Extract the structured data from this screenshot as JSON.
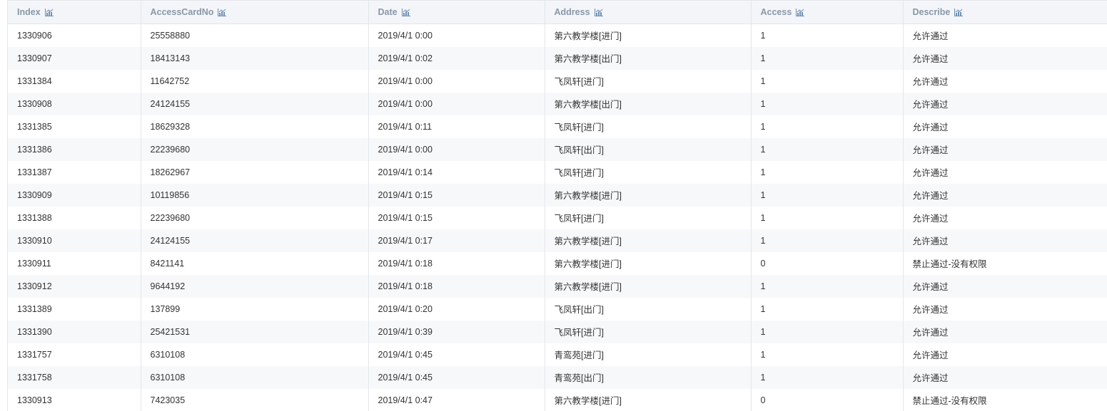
{
  "table": {
    "columns": [
      {
        "label": "Index",
        "icon": "chart-icon"
      },
      {
        "label": "AccessCardNo",
        "icon": "chart-icon"
      },
      {
        "label": "Date",
        "icon": "chart-icon"
      },
      {
        "label": "Address",
        "icon": "chart-icon"
      },
      {
        "label": "Access",
        "icon": "chart-icon"
      },
      {
        "label": "Describe",
        "icon": "chart-icon"
      }
    ],
    "rows": [
      [
        "1330906",
        "25558880",
        "2019/4/1 0:00",
        "第六教学楼[进门]",
        "1",
        "允许通过"
      ],
      [
        "1330907",
        "18413143",
        "2019/4/1 0:02",
        "第六教学楼[出门]",
        "1",
        "允许通过"
      ],
      [
        "1331384",
        "11642752",
        "2019/4/1 0:00",
        "飞凤轩[进门]",
        "1",
        "允许通过"
      ],
      [
        "1330908",
        "24124155",
        "2019/4/1 0:00",
        "第六教学楼[出门]",
        "1",
        "允许通过"
      ],
      [
        "1331385",
        "18629328",
        "2019/4/1 0:11",
        "飞凤轩[进门]",
        "1",
        "允许通过"
      ],
      [
        "1331386",
        "22239680",
        "2019/4/1 0:00",
        "飞凤轩[出门]",
        "1",
        "允许通过"
      ],
      [
        "1331387",
        "18262967",
        "2019/4/1 0:14",
        "飞凤轩[进门]",
        "1",
        "允许通过"
      ],
      [
        "1330909",
        "10119856",
        "2019/4/1 0:15",
        "第六教学楼[进门]",
        "1",
        "允许通过"
      ],
      [
        "1331388",
        "22239680",
        "2019/4/1 0:15",
        "飞凤轩[进门]",
        "1",
        "允许通过"
      ],
      [
        "1330910",
        "24124155",
        "2019/4/1 0:17",
        "第六教学楼[进门]",
        "1",
        "允许通过"
      ],
      [
        "1330911",
        "8421141",
        "2019/4/1 0:18",
        "第六教学楼[进门]",
        "0",
        "禁止通过-没有权限"
      ],
      [
        "1330912",
        "9644192",
        "2019/4/1 0:18",
        "第六教学楼[进门]",
        "1",
        "允许通过"
      ],
      [
        "1331389",
        "137899",
        "2019/4/1 0:20",
        "飞凤轩[出门]",
        "1",
        "允许通过"
      ],
      [
        "1331390",
        "25421531",
        "2019/4/1 0:39",
        "飞凤轩[进门]",
        "1",
        "允许通过"
      ],
      [
        "1331757",
        "6310108",
        "2019/4/1 0:45",
        "青鸾苑[进门]",
        "1",
        "允许通过"
      ],
      [
        "1331758",
        "6310108",
        "2019/4/1 0:45",
        "青鸾苑[出门]",
        "1",
        "允许通过"
      ],
      [
        "1330913",
        "7423035",
        "2019/4/1 0:47",
        "第六教学楼[进门]",
        "0",
        "禁止通过-没有权限"
      ]
    ]
  },
  "colors": {
    "header_text": "#8a97a8",
    "header_bg": "#f3f5f8",
    "icon_color": "#6f8fb5",
    "row_alt_bg": "#f7f8fa",
    "cell_text": "#333333",
    "border": "#e3e6ea"
  }
}
